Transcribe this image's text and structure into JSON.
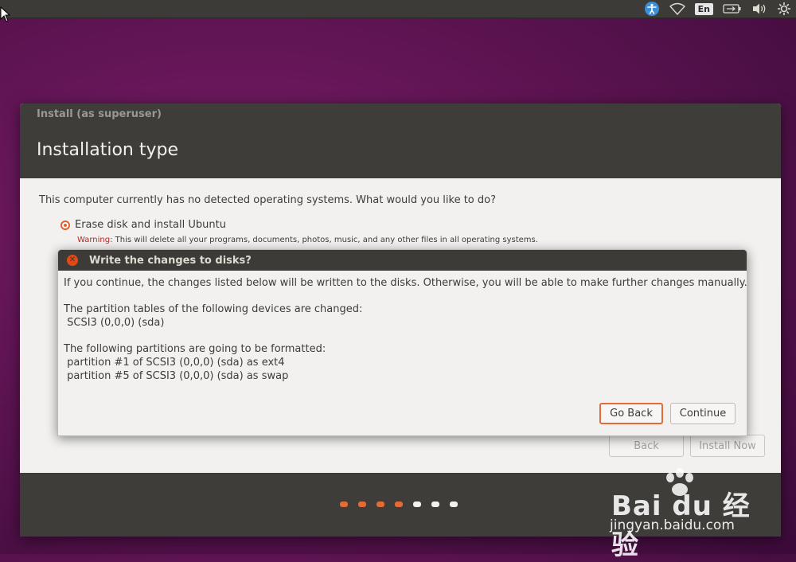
{
  "top_panel": {
    "language": "En",
    "icons": [
      "accessibility-icon",
      "wifi-icon",
      "keyboard-language-icon",
      "battery-icon",
      "volume-icon",
      "power-icon"
    ]
  },
  "installer": {
    "window_title": "Install (as superuser)",
    "heading": "Installation type",
    "question": "This computer currently has no detected operating systems. What would you like to do?",
    "option_erase": "Erase disk and install Ubuntu",
    "warning_label": "Warning:",
    "warning_text": " This will delete all your programs, documents, photos, music, and any other files in all operating systems.",
    "back_label": "Back",
    "install_now_label": "Install Now",
    "progress": {
      "total_steps": 7,
      "current_step": 4
    }
  },
  "dialog": {
    "title": "Write the changes to disks?",
    "intro": "If you continue, the changes listed below will be written to the disks. Otherwise, you will be able to make further changes manually.",
    "partition_tables_heading": "The partition tables of the following devices are changed:",
    "partition_tables_device": " SCSI3 (0,0,0) (sda)",
    "formatted_heading": "The following partitions are going to be formatted:",
    "formatted_1": " partition #1 of SCSI3 (0,0,0) (sda) as ext4",
    "formatted_2": " partition #5 of SCSI3 (0,0,0) (sda) as swap",
    "go_back_label": "Go Back",
    "continue_label": "Continue"
  },
  "watermark": {
    "brand": "Bai du 经验",
    "url": "jingyan.baidu.com"
  },
  "colors": {
    "accent": "#e36c35",
    "header": "#3e3d39",
    "window_bg": "#f2f1f0",
    "warning": "#b3261e"
  }
}
